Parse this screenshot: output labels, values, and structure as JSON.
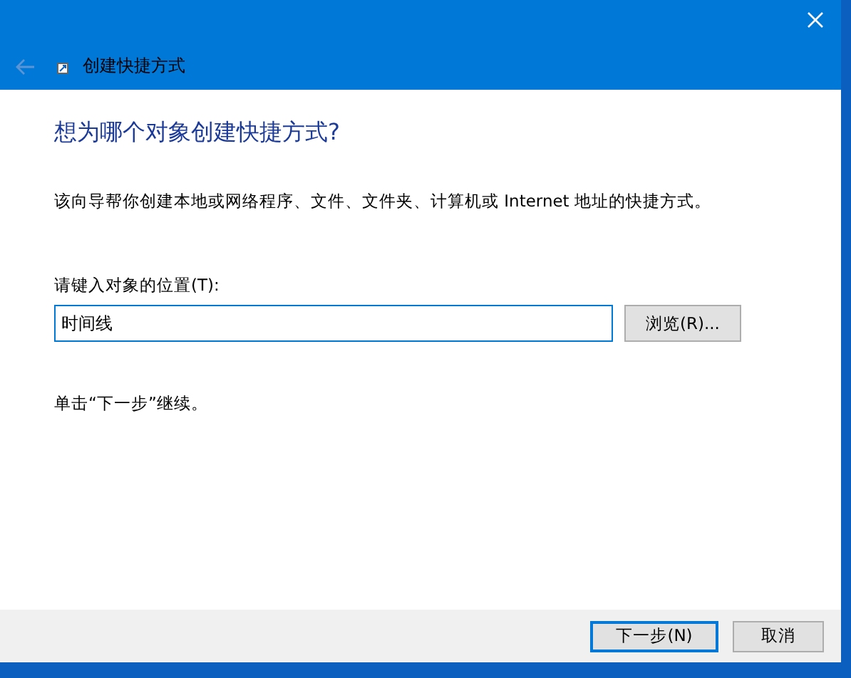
{
  "window": {
    "title": "创建快捷方式",
    "back_disabled": true
  },
  "heading": "想为哪个对象创建快捷方式?",
  "description": "该向导帮你创建本地或网络程序、文件、文件夹、计算机或 Internet 地址的快捷方式。",
  "location": {
    "label": "请键入对象的位置(T):",
    "value": "时间线",
    "browse_button": "浏览(R)..."
  },
  "hint": "单击“下一步”继续。",
  "buttons": [
    {
      "label": "下一步(N)",
      "selected": true
    },
    {
      "label": "取消",
      "selected": false
    }
  ]
}
